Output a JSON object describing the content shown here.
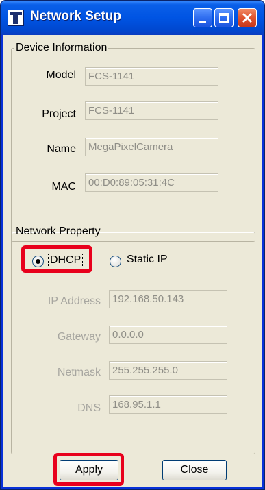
{
  "window": {
    "title": "Network Setup"
  },
  "device_info": {
    "legend": "Device Information",
    "fields": [
      {
        "label": "Model",
        "value": "FCS-1141"
      },
      {
        "label": "Project",
        "value": "FCS-1141"
      },
      {
        "label": "Name",
        "value": "MegaPixelCamera"
      },
      {
        "label": "MAC",
        "value": "00:D0:89:05:31:4C"
      }
    ]
  },
  "network_property": {
    "legend": "Network Property",
    "mode_options": [
      {
        "label": "DHCP",
        "selected": true
      },
      {
        "label": "Static IP",
        "selected": false
      }
    ],
    "fields": [
      {
        "label": "IP Address",
        "value": "192.168.50.143"
      },
      {
        "label": "Gateway",
        "value": "0.0.0.0"
      },
      {
        "label": "Netmask",
        "value": "255.255.255.0"
      },
      {
        "label": "DNS",
        "value": "168.95.1.1"
      }
    ]
  },
  "buttons": {
    "apply": "Apply",
    "close": "Close"
  },
  "colors": {
    "title_bar": "#0054e3",
    "close_button": "#e0542f",
    "highlight_box": "#e8001c",
    "dialog_background": "#ece9d8"
  },
  "icons": [
    "app-icon",
    "minimize-icon",
    "maximize-icon",
    "close-icon"
  ]
}
